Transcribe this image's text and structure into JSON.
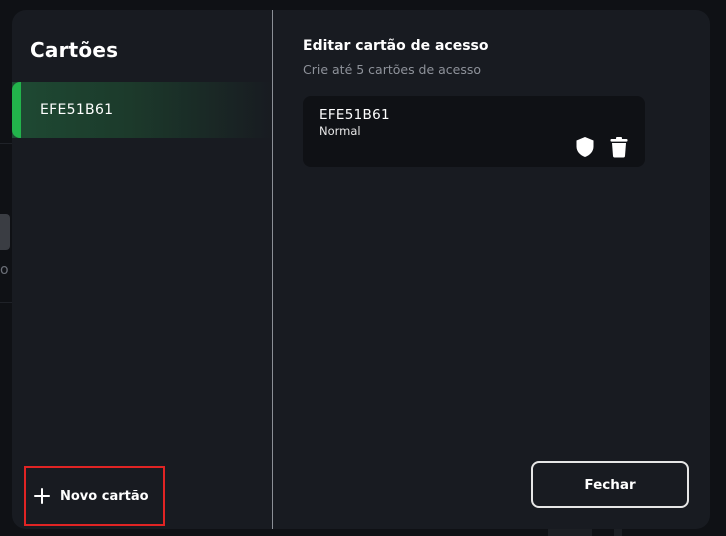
{
  "background": {
    "partial_text": "o"
  },
  "modal": {
    "left": {
      "title": "Cartões",
      "items": [
        {
          "label": "EFE51B61",
          "selected": true
        }
      ],
      "new_card_label": "Novo cartão"
    },
    "right": {
      "title": "Editar cartão de acesso",
      "subtitle": "Crie até 5 cartões de acesso",
      "cards": [
        {
          "id": "EFE51B61",
          "type": "Normal"
        }
      ],
      "close_label": "Fechar"
    }
  },
  "icons": {
    "add": "plus-icon",
    "permissions": "shield-icon",
    "delete": "trash-icon"
  },
  "colors": {
    "accent_green": "#22b34b",
    "highlight_red": "#e02424",
    "modal_bg": "#181b21",
    "card_bg": "#0f1115"
  }
}
